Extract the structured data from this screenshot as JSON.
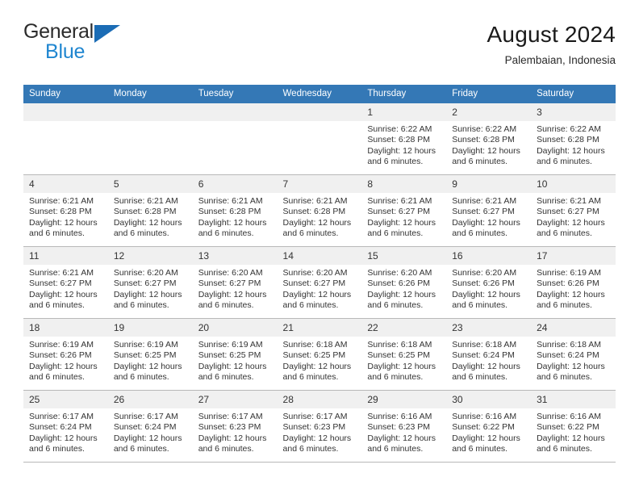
{
  "brand": {
    "name_part1": "General",
    "name_part2": "Blue",
    "logo_icon": "blue-triangle-icon",
    "colors": {
      "dark": "#2b2b2b",
      "blue": "#1f86d0",
      "triangle": "#1b6cb5"
    }
  },
  "header": {
    "title": "August 2024",
    "subtitle": "Palembaian, Indonesia"
  },
  "theme": {
    "header_row_bg": "#3478b6",
    "header_row_text": "#ffffff",
    "daynum_bg": "#f0f0f0",
    "cell_border": "#b8b8b8"
  },
  "weekdays": [
    "Sunday",
    "Monday",
    "Tuesday",
    "Wednesday",
    "Thursday",
    "Friday",
    "Saturday"
  ],
  "weeks": [
    [
      {
        "day": "",
        "sunrise": "",
        "sunset": "",
        "daylight1": "",
        "daylight2": "",
        "empty": true
      },
      {
        "day": "",
        "sunrise": "",
        "sunset": "",
        "daylight1": "",
        "daylight2": "",
        "empty": true
      },
      {
        "day": "",
        "sunrise": "",
        "sunset": "",
        "daylight1": "",
        "daylight2": "",
        "empty": true
      },
      {
        "day": "",
        "sunrise": "",
        "sunset": "",
        "daylight1": "",
        "daylight2": "",
        "empty": true
      },
      {
        "day": "1",
        "sunrise": "Sunrise: 6:22 AM",
        "sunset": "Sunset: 6:28 PM",
        "daylight1": "Daylight: 12 hours",
        "daylight2": "and 6 minutes."
      },
      {
        "day": "2",
        "sunrise": "Sunrise: 6:22 AM",
        "sunset": "Sunset: 6:28 PM",
        "daylight1": "Daylight: 12 hours",
        "daylight2": "and 6 minutes."
      },
      {
        "day": "3",
        "sunrise": "Sunrise: 6:22 AM",
        "sunset": "Sunset: 6:28 PM",
        "daylight1": "Daylight: 12 hours",
        "daylight2": "and 6 minutes."
      }
    ],
    [
      {
        "day": "4",
        "sunrise": "Sunrise: 6:21 AM",
        "sunset": "Sunset: 6:28 PM",
        "daylight1": "Daylight: 12 hours",
        "daylight2": "and 6 minutes."
      },
      {
        "day": "5",
        "sunrise": "Sunrise: 6:21 AM",
        "sunset": "Sunset: 6:28 PM",
        "daylight1": "Daylight: 12 hours",
        "daylight2": "and 6 minutes."
      },
      {
        "day": "6",
        "sunrise": "Sunrise: 6:21 AM",
        "sunset": "Sunset: 6:28 PM",
        "daylight1": "Daylight: 12 hours",
        "daylight2": "and 6 minutes."
      },
      {
        "day": "7",
        "sunrise": "Sunrise: 6:21 AM",
        "sunset": "Sunset: 6:28 PM",
        "daylight1": "Daylight: 12 hours",
        "daylight2": "and 6 minutes."
      },
      {
        "day": "8",
        "sunrise": "Sunrise: 6:21 AM",
        "sunset": "Sunset: 6:27 PM",
        "daylight1": "Daylight: 12 hours",
        "daylight2": "and 6 minutes."
      },
      {
        "day": "9",
        "sunrise": "Sunrise: 6:21 AM",
        "sunset": "Sunset: 6:27 PM",
        "daylight1": "Daylight: 12 hours",
        "daylight2": "and 6 minutes."
      },
      {
        "day": "10",
        "sunrise": "Sunrise: 6:21 AM",
        "sunset": "Sunset: 6:27 PM",
        "daylight1": "Daylight: 12 hours",
        "daylight2": "and 6 minutes."
      }
    ],
    [
      {
        "day": "11",
        "sunrise": "Sunrise: 6:21 AM",
        "sunset": "Sunset: 6:27 PM",
        "daylight1": "Daylight: 12 hours",
        "daylight2": "and 6 minutes."
      },
      {
        "day": "12",
        "sunrise": "Sunrise: 6:20 AM",
        "sunset": "Sunset: 6:27 PM",
        "daylight1": "Daylight: 12 hours",
        "daylight2": "and 6 minutes."
      },
      {
        "day": "13",
        "sunrise": "Sunrise: 6:20 AM",
        "sunset": "Sunset: 6:27 PM",
        "daylight1": "Daylight: 12 hours",
        "daylight2": "and 6 minutes."
      },
      {
        "day": "14",
        "sunrise": "Sunrise: 6:20 AM",
        "sunset": "Sunset: 6:27 PM",
        "daylight1": "Daylight: 12 hours",
        "daylight2": "and 6 minutes."
      },
      {
        "day": "15",
        "sunrise": "Sunrise: 6:20 AM",
        "sunset": "Sunset: 6:26 PM",
        "daylight1": "Daylight: 12 hours",
        "daylight2": "and 6 minutes."
      },
      {
        "day": "16",
        "sunrise": "Sunrise: 6:20 AM",
        "sunset": "Sunset: 6:26 PM",
        "daylight1": "Daylight: 12 hours",
        "daylight2": "and 6 minutes."
      },
      {
        "day": "17",
        "sunrise": "Sunrise: 6:19 AM",
        "sunset": "Sunset: 6:26 PM",
        "daylight1": "Daylight: 12 hours",
        "daylight2": "and 6 minutes."
      }
    ],
    [
      {
        "day": "18",
        "sunrise": "Sunrise: 6:19 AM",
        "sunset": "Sunset: 6:26 PM",
        "daylight1": "Daylight: 12 hours",
        "daylight2": "and 6 minutes."
      },
      {
        "day": "19",
        "sunrise": "Sunrise: 6:19 AM",
        "sunset": "Sunset: 6:25 PM",
        "daylight1": "Daylight: 12 hours",
        "daylight2": "and 6 minutes."
      },
      {
        "day": "20",
        "sunrise": "Sunrise: 6:19 AM",
        "sunset": "Sunset: 6:25 PM",
        "daylight1": "Daylight: 12 hours",
        "daylight2": "and 6 minutes."
      },
      {
        "day": "21",
        "sunrise": "Sunrise: 6:18 AM",
        "sunset": "Sunset: 6:25 PM",
        "daylight1": "Daylight: 12 hours",
        "daylight2": "and 6 minutes."
      },
      {
        "day": "22",
        "sunrise": "Sunrise: 6:18 AM",
        "sunset": "Sunset: 6:25 PM",
        "daylight1": "Daylight: 12 hours",
        "daylight2": "and 6 minutes."
      },
      {
        "day": "23",
        "sunrise": "Sunrise: 6:18 AM",
        "sunset": "Sunset: 6:24 PM",
        "daylight1": "Daylight: 12 hours",
        "daylight2": "and 6 minutes."
      },
      {
        "day": "24",
        "sunrise": "Sunrise: 6:18 AM",
        "sunset": "Sunset: 6:24 PM",
        "daylight1": "Daylight: 12 hours",
        "daylight2": "and 6 minutes."
      }
    ],
    [
      {
        "day": "25",
        "sunrise": "Sunrise: 6:17 AM",
        "sunset": "Sunset: 6:24 PM",
        "daylight1": "Daylight: 12 hours",
        "daylight2": "and 6 minutes."
      },
      {
        "day": "26",
        "sunrise": "Sunrise: 6:17 AM",
        "sunset": "Sunset: 6:24 PM",
        "daylight1": "Daylight: 12 hours",
        "daylight2": "and 6 minutes."
      },
      {
        "day": "27",
        "sunrise": "Sunrise: 6:17 AM",
        "sunset": "Sunset: 6:23 PM",
        "daylight1": "Daylight: 12 hours",
        "daylight2": "and 6 minutes."
      },
      {
        "day": "28",
        "sunrise": "Sunrise: 6:17 AM",
        "sunset": "Sunset: 6:23 PM",
        "daylight1": "Daylight: 12 hours",
        "daylight2": "and 6 minutes."
      },
      {
        "day": "29",
        "sunrise": "Sunrise: 6:16 AM",
        "sunset": "Sunset: 6:23 PM",
        "daylight1": "Daylight: 12 hours",
        "daylight2": "and 6 minutes."
      },
      {
        "day": "30",
        "sunrise": "Sunrise: 6:16 AM",
        "sunset": "Sunset: 6:22 PM",
        "daylight1": "Daylight: 12 hours",
        "daylight2": "and 6 minutes."
      },
      {
        "day": "31",
        "sunrise": "Sunrise: 6:16 AM",
        "sunset": "Sunset: 6:22 PM",
        "daylight1": "Daylight: 12 hours",
        "daylight2": "and 6 minutes."
      }
    ]
  ]
}
